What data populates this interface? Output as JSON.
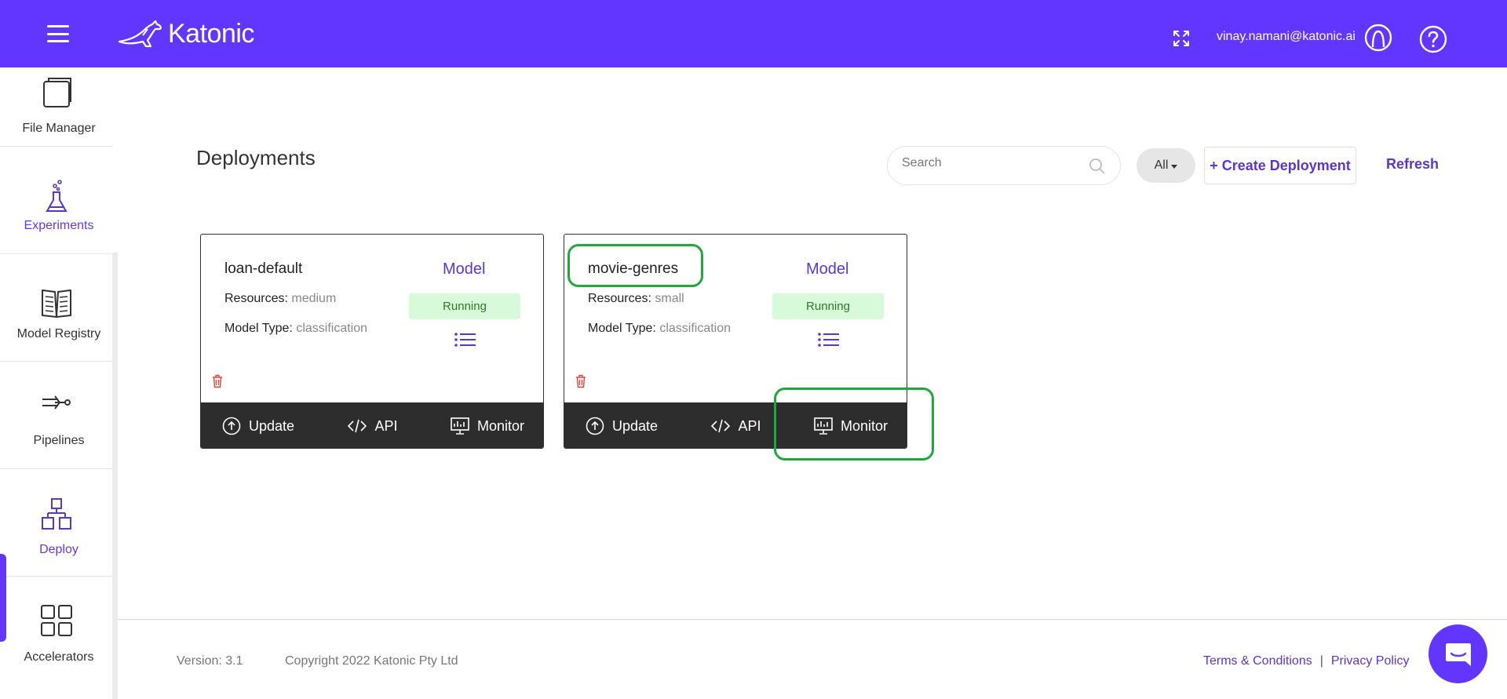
{
  "header": {
    "logo_text": "Katonic",
    "user_email": "vinay.namani@katonic.ai",
    "brand_color": "#6236ff"
  },
  "sidebar": {
    "items": [
      {
        "label": "File Manager",
        "icon": "folder-icon"
      },
      {
        "label": "Experiments",
        "icon": "flask-icon"
      },
      {
        "label": "Model Registry",
        "icon": "book-icon"
      },
      {
        "label": "Pipelines",
        "icon": "pipeline-icon"
      },
      {
        "label": "Deploy",
        "icon": "deploy-icon",
        "active": true
      },
      {
        "label": "Accelerators",
        "icon": "grid-icon"
      }
    ]
  },
  "main": {
    "title": "Deployments",
    "search": {
      "placeholder": "Search",
      "value": ""
    },
    "filter": {
      "selected": "All"
    },
    "create_label": "+ Create Deployment",
    "refresh_label": "Refresh"
  },
  "cards": [
    {
      "name": "loan-default",
      "type": "Model",
      "resources_key": "Resources:",
      "resources_val": "medium",
      "model_type_key": "Model Type:",
      "model_type_val": "classification",
      "status": "Running",
      "actions": {
        "update": "Update",
        "api": "API",
        "monitor": "Monitor"
      }
    },
    {
      "name": "movie-genres",
      "type": "Model",
      "resources_key": "Resources:",
      "resources_val": "small",
      "model_type_key": "Model Type:",
      "model_type_val": "classification",
      "status": "Running",
      "actions": {
        "update": "Update",
        "api": "API",
        "monitor": "Monitor"
      }
    }
  ],
  "footer": {
    "version": "Version: 3.1",
    "copyright": "Copyright 2022 Katonic Pty Ltd",
    "terms": "Terms & Conditions",
    "separator": "|",
    "privacy": "Privacy Policy"
  },
  "colors": {
    "accent": "#6236ff",
    "link": "#5a35d6",
    "status_bg": "#d7fbd8",
    "status_text": "#2b7a2b",
    "card_footer": "#2d2d2d",
    "highlight": "#20a83a"
  }
}
